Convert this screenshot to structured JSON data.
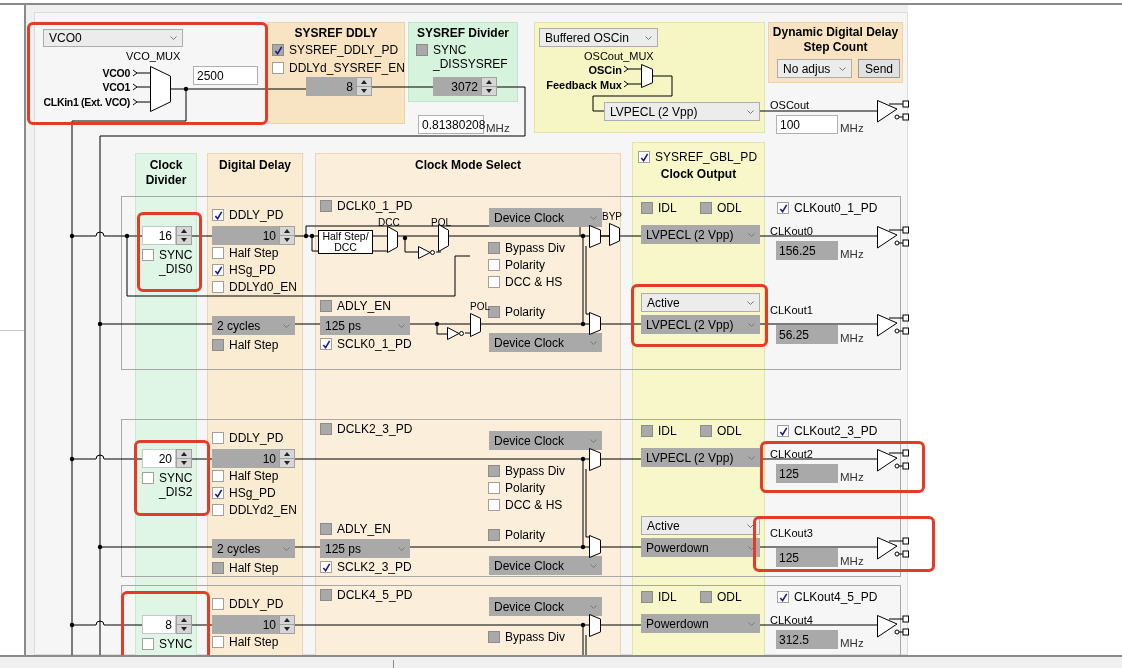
{
  "vco_mux": {
    "select": {
      "value": "VCO0",
      "disabled": false
    },
    "label": "VCO_MUX",
    "inputs": [
      "VCO0",
      "VCO1",
      "CLKin1 (Ext. VCO)"
    ],
    "frequency": {
      "value": "2500",
      "disabled": false
    }
  },
  "sysref_ddly": {
    "title": "SYSREF DDLY",
    "checkboxes": [
      {
        "label": "SYSREF_DDLY_PD",
        "checked": true,
        "disabled": true
      },
      {
        "label": "DDLYd_SYSREF_EN",
        "checked": false,
        "disabled": false
      }
    ],
    "spinner": {
      "value": "8",
      "disabled": true
    }
  },
  "sysref_divider": {
    "title": "SYSREF Divider",
    "checkbox": {
      "label": "SYNC _DISSYSREF",
      "checked": false,
      "disabled": true
    },
    "spinner": {
      "value": "3072",
      "disabled": true
    },
    "frequency": {
      "value": "0.81380208",
      "disabled": false
    },
    "unit": "MHz"
  },
  "oscout": {
    "select": {
      "value": "Buffered OSCin",
      "disabled": false
    },
    "mux_label": "OSCout_MUX",
    "inputs": [
      "OSCin",
      "Feedback Mux"
    ],
    "format": {
      "value": "LVPECL (2 Vpp)",
      "disabled": false
    },
    "output_label": "OSCout",
    "frequency": {
      "value": "100",
      "disabled": false
    },
    "unit": "MHz"
  },
  "dynamic_delay": {
    "title": "Dynamic Digital Delay Step Count",
    "select": {
      "value": "No adjus",
      "disabled": false
    },
    "button": "Send"
  },
  "column_headers": [
    "Clock Divider",
    "Digital Delay",
    "Clock Mode Select"
  ],
  "clock_output_header": {
    "checkbox": {
      "label": "SYSREF_GBL_PD",
      "checked": true,
      "disabled": false
    },
    "title": "Clock Output"
  },
  "groups": [
    {
      "divider": {
        "value": "16",
        "disabled": false
      },
      "sync": {
        "label": "SYNC _DIS0",
        "checked": false,
        "disabled": false
      },
      "ddly_pd": {
        "label": "DDLY_PD",
        "checked": true,
        "disabled": false
      },
      "ddly": {
        "value": "10",
        "disabled": true
      },
      "ddly_options": [
        {
          "label": "Half Step",
          "checked": false,
          "disabled": false
        },
        {
          "label": "HSg_PD",
          "checked": true,
          "disabled": false
        },
        {
          "label": "DDLYd0_EN",
          "checked": false,
          "disabled": false
        }
      ],
      "sysref_delay": {
        "value": "2 cycles",
        "disabled": true
      },
      "sysref_half_step": {
        "label": "Half Step",
        "checked": false,
        "disabled": true
      },
      "dclk_pd": {
        "label": "DCLK0_1_PD",
        "checked": false,
        "disabled": true
      },
      "dcc_block": {
        "box": "Half Step/ DCC",
        "labels": [
          "DCC",
          "POL",
          "POL",
          "BYP"
        ]
      },
      "adly_en": {
        "label": "ADLY_EN",
        "checked": false,
        "disabled": true
      },
      "adly": {
        "value": "125 ps",
        "disabled": true
      },
      "sclk_pd": {
        "label": "SCLK0_1_PD",
        "checked": true,
        "disabled": false
      },
      "device_select": {
        "value": "Device Clock",
        "disabled": true
      },
      "mode_options": [
        {
          "label": "Bypass Div",
          "checked": false,
          "disabled": true
        },
        {
          "label": "Polarity",
          "checked": false,
          "disabled": false
        },
        {
          "label": "DCC & HS",
          "checked": false,
          "disabled": false
        }
      ],
      "sysref_polarity": {
        "label": "Polarity",
        "checked": false,
        "disabled": true
      },
      "sysref_select": {
        "value": "Device Clock",
        "disabled": true
      },
      "idl": {
        "label": "IDL",
        "checked": false,
        "disabled": true
      },
      "odl": {
        "label": "ODL",
        "checked": false,
        "disabled": true
      },
      "clkout_pd": {
        "label": "CLKout0_1_PD",
        "checked": true,
        "disabled": false
      },
      "outputs": [
        {
          "label": "CLKout0",
          "format": {
            "value": "LVPECL (2 Vpp)",
            "disabled": true
          },
          "frequency": {
            "value": "156.25",
            "disabled": true
          },
          "unit": "MHz"
        },
        {
          "label": "CLKout1",
          "mode": {
            "value": "Active",
            "disabled": false
          },
          "format": {
            "value": "LVPECL (2 Vpp)",
            "disabled": true
          },
          "frequency": {
            "value": "56.25",
            "disabled": true
          },
          "unit": "MHz"
        }
      ]
    },
    {
      "divider": {
        "value": "20",
        "disabled": false
      },
      "sync": {
        "label": "SYNC _DIS2",
        "checked": false,
        "disabled": false
      },
      "ddly_pd": {
        "label": "DDLY_PD",
        "checked": false,
        "disabled": false
      },
      "ddly": {
        "value": "10",
        "disabled": true
      },
      "ddly_options": [
        {
          "label": "Half Step",
          "checked": false,
          "disabled": false
        },
        {
          "label": "HSg_PD",
          "checked": true,
          "disabled": false
        },
        {
          "label": "DDLYd2_EN",
          "checked": false,
          "disabled": false
        }
      ],
      "sysref_delay": {
        "value": "2 cycles",
        "disabled": true
      },
      "sysref_half_step": {
        "label": "Half Step",
        "checked": false,
        "disabled": true
      },
      "dclk_pd": {
        "label": "DCLK2_3_PD",
        "checked": false,
        "disabled": true
      },
      "adly_en": {
        "label": "ADLY_EN",
        "checked": false,
        "disabled": true
      },
      "adly": {
        "value": "125 ps",
        "disabled": true
      },
      "sclk_pd": {
        "label": "SCLK2_3_PD",
        "checked": true,
        "disabled": false
      },
      "device_select": {
        "value": "Device Clock",
        "disabled": true
      },
      "mode_options": [
        {
          "label": "Bypass Div",
          "checked": false,
          "disabled": true
        },
        {
          "label": "Polarity",
          "checked": false,
          "disabled": false
        },
        {
          "label": "DCC & HS",
          "checked": false,
          "disabled": false
        }
      ],
      "sysref_polarity": {
        "label": "Polarity",
        "checked": false,
        "disabled": true
      },
      "sysref_select": {
        "value": "Device Clock",
        "disabled": true
      },
      "idl": {
        "label": "IDL",
        "checked": false,
        "disabled": true
      },
      "odl": {
        "label": "ODL",
        "checked": false,
        "disabled": true
      },
      "clkout_pd": {
        "label": "CLKout2_3_PD",
        "checked": true,
        "disabled": false
      },
      "outputs": [
        {
          "label": "CLKout2",
          "format": {
            "value": "LVPECL (2 Vpp)",
            "disabled": true
          },
          "frequency": {
            "value": "125",
            "disabled": true
          },
          "unit": "MHz"
        },
        {
          "label": "CLKout3",
          "mode": {
            "value": "Active",
            "disabled": false
          },
          "format": {
            "value": "Powerdown",
            "disabled": true
          },
          "frequency": {
            "value": "125",
            "disabled": true
          },
          "unit": "MHz"
        }
      ]
    },
    {
      "divider": {
        "value": "8",
        "disabled": false
      },
      "sync": {
        "label": "SYNC",
        "checked": false,
        "disabled": false
      },
      "ddly_pd": {
        "label": "DDLY_PD",
        "checked": false,
        "disabled": false
      },
      "ddly": {
        "value": "10",
        "disabled": true
      },
      "ddly_options": [
        {
          "label": "Half Step",
          "checked": false,
          "disabled": false
        }
      ],
      "dclk_pd": {
        "label": "DCLK4_5_PD",
        "checked": false,
        "disabled": true
      },
      "device_select": {
        "value": "Device Clock",
        "disabled": true
      },
      "mode_options": [
        {
          "label": "Bypass Div",
          "checked": false,
          "disabled": true
        }
      ],
      "idl": {
        "label": "IDL",
        "checked": false,
        "disabled": true
      },
      "odl": {
        "label": "ODL",
        "checked": false,
        "disabled": true
      },
      "clkout_pd": {
        "label": "CLKout4_5_PD",
        "checked": true,
        "disabled": false
      },
      "outputs": [
        {
          "label": "CLKout4",
          "format": {
            "value": "Powerdown",
            "disabled": true
          },
          "frequency": {
            "value": "312.5",
            "disabled": true
          },
          "unit": "MHz"
        }
      ]
    }
  ]
}
